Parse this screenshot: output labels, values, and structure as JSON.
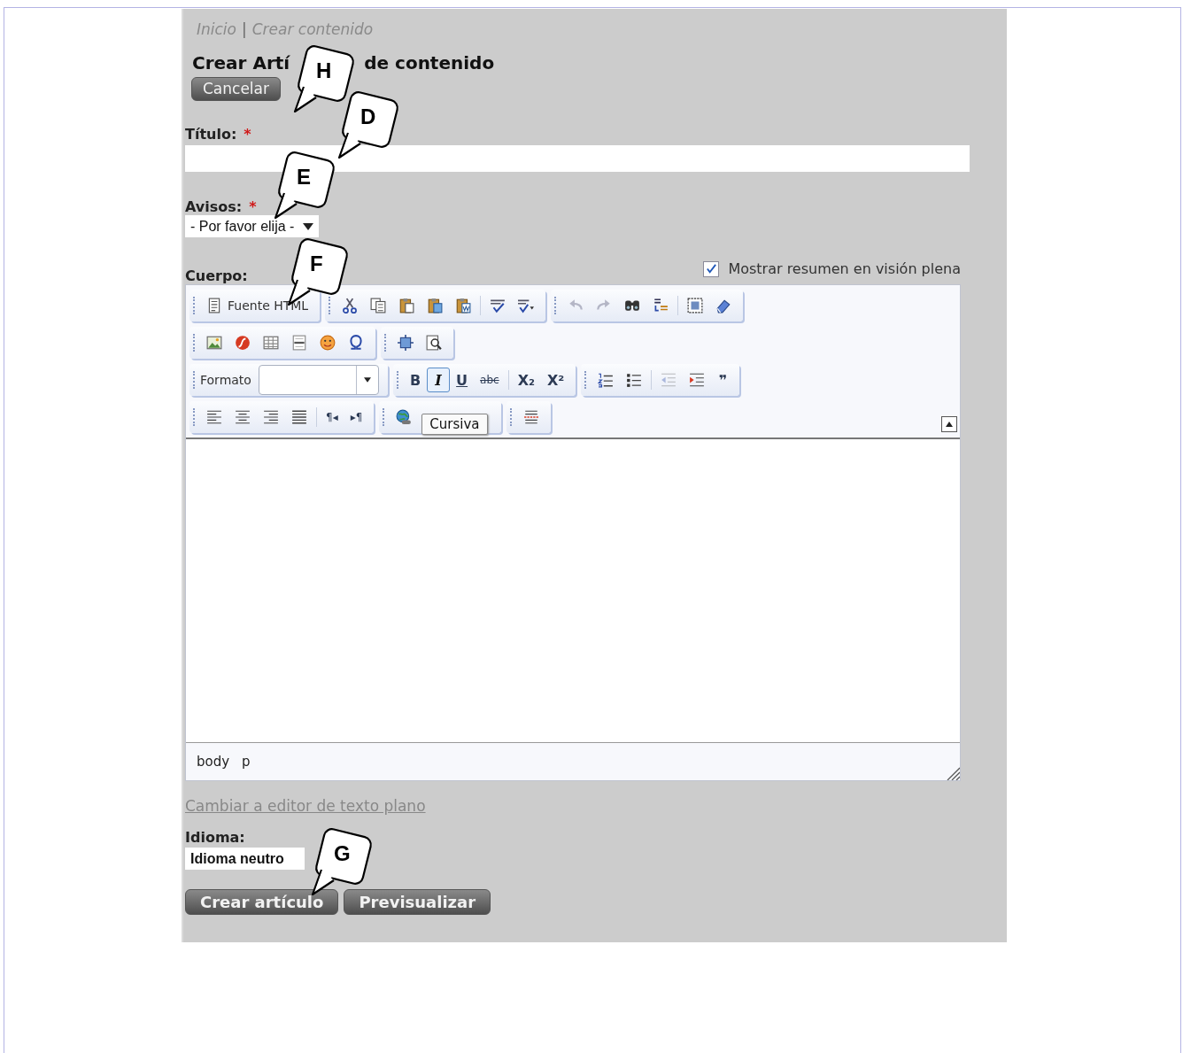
{
  "breadcrumb": {
    "items": [
      {
        "label": "Inicio"
      },
      {
        "label": "Crear contenido"
      }
    ],
    "separator": "|"
  },
  "heading_parts": [
    "Crear Artí",
    "de contenido"
  ],
  "cancel_button": "Cancelar",
  "fields": [
    {
      "kind": "text",
      "label": "Título:",
      "required_mark": "*"
    },
    {
      "kind": "select",
      "label": "Avisos:",
      "required_mark": "*",
      "value": "- Por favor elija -"
    }
  ],
  "summary_toggle": {
    "label": "Mostrar resumen en visión plena",
    "checked": true
  },
  "body_label": "Cuerpo:",
  "toolbar_rows": [
    [
      {
        "items": [
          {
            "kind": "button",
            "label": "Fuente HTML",
            "disabled": false,
            "active": false
          }
        ]
      },
      {
        "items": [
          {
            "kind": "button",
            "disabled": false,
            "active": false
          },
          {
            "kind": "button",
            "disabled": false,
            "active": false
          },
          {
            "kind": "button",
            "disabled": false,
            "active": false
          },
          {
            "kind": "button",
            "disabled": false,
            "active": false
          },
          {
            "kind": "button",
            "disabled": false,
            "active": false
          },
          {
            "kind": "separator"
          },
          {
            "kind": "button",
            "disabled": false,
            "active": false
          },
          {
            "kind": "button",
            "disabled": false,
            "active": false
          }
        ]
      },
      {
        "items": [
          {
            "kind": "button",
            "disabled": true,
            "active": false
          },
          {
            "kind": "button",
            "disabled": true,
            "active": false
          },
          {
            "kind": "button",
            "disabled": false,
            "active": false
          },
          {
            "kind": "button",
            "disabled": false,
            "active": false
          },
          {
            "kind": "separator"
          },
          {
            "kind": "button",
            "disabled": false,
            "active": false
          },
          {
            "kind": "button",
            "disabled": false,
            "active": false
          }
        ]
      }
    ],
    [
      {
        "items": [
          {
            "kind": "button",
            "disabled": false,
            "active": false
          },
          {
            "kind": "button",
            "disabled": false,
            "active": false
          },
          {
            "kind": "button",
            "disabled": false,
            "active": false
          },
          {
            "kind": "button",
            "disabled": false,
            "active": false
          },
          {
            "kind": "button",
            "disabled": false,
            "active": false
          },
          {
            "kind": "button",
            "disabled": false,
            "active": false
          }
        ]
      },
      {
        "items": [
          {
            "kind": "button",
            "disabled": false,
            "active": false
          },
          {
            "kind": "button",
            "disabled": false,
            "active": false
          }
        ]
      }
    ],
    [
      {
        "items": [
          {
            "kind": "combo",
            "label": "Formato"
          }
        ]
      },
      {
        "items": [
          {
            "kind": "glyph",
            "glyph": "B",
            "disabled": false,
            "active": false
          },
          {
            "kind": "glyph",
            "glyph": "I",
            "disabled": false,
            "active": true
          },
          {
            "kind": "glyph",
            "glyph": "U",
            "disabled": false,
            "active": false
          },
          {
            "kind": "glyph",
            "glyph": "abc",
            "disabled": false,
            "active": false
          },
          {
            "kind": "separator"
          },
          {
            "kind": "glyph",
            "glyph": "X₂",
            "disabled": false,
            "active": false
          },
          {
            "kind": "glyph",
            "glyph": "X²",
            "disabled": false,
            "active": false
          }
        ]
      },
      {
        "items": [
          {
            "kind": "button",
            "disabled": false,
            "active": false
          },
          {
            "kind": "button",
            "disabled": false,
            "active": false
          },
          {
            "kind": "separator"
          },
          {
            "kind": "button",
            "disabled": true,
            "active": false
          },
          {
            "kind": "button",
            "disabled": false,
            "active": false
          },
          {
            "kind": "glyph",
            "glyph": "❞",
            "disabled": false,
            "active": false
          }
        ]
      }
    ],
    [
      {
        "items": [
          {
            "kind": "button",
            "disabled": false,
            "active": false
          },
          {
            "kind": "button",
            "disabled": false,
            "active": false
          },
          {
            "kind": "button",
            "disabled": false,
            "active": false
          },
          {
            "kind": "button",
            "disabled": false,
            "active": false
          },
          {
            "kind": "separator"
          },
          {
            "kind": "glyph",
            "glyph": "¶◂",
            "disabled": false,
            "active": false
          },
          {
            "kind": "glyph",
            "glyph": "▸¶",
            "disabled": false,
            "active": false
          }
        ]
      },
      {
        "items": [
          {
            "kind": "button",
            "disabled": false,
            "active": false
          }
        ],
        "tooltip": "Cursiva"
      },
      {
        "items": [
          {
            "kind": "button",
            "disabled": false,
            "active": false
          }
        ]
      }
    ]
  ],
  "path_bar": [
    "body",
    "p"
  ],
  "plain_editor_link": "Cambiar a editor de texto plano",
  "language": {
    "label": "Idioma:",
    "value": "Idioma neutro"
  },
  "buttons": [
    "Crear artículo",
    "Previsualizar"
  ],
  "callouts": [
    {
      "letter": "H"
    },
    {
      "letter": "D"
    },
    {
      "letter": "E"
    },
    {
      "letter": "F"
    },
    {
      "letter": "G"
    }
  ]
}
